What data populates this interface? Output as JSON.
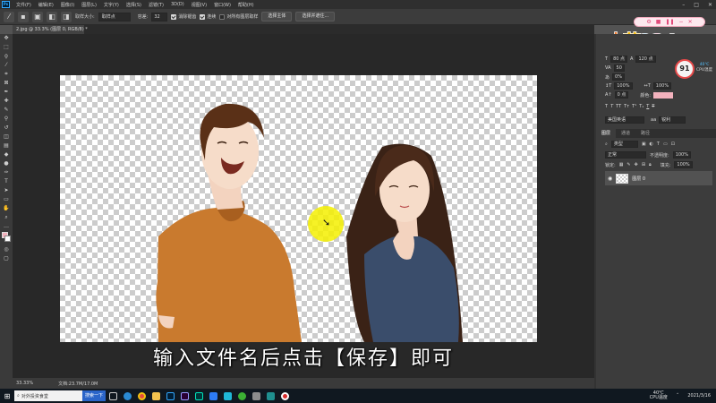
{
  "menubar": {
    "app_logo": "Ps",
    "items": [
      "文件(F)",
      "编辑(E)",
      "图像(I)",
      "图层(L)",
      "文字(Y)",
      "选择(S)",
      "滤镜(T)",
      "3D(D)",
      "视图(V)",
      "窗口(W)",
      "帮助(H)"
    ]
  },
  "options_bar": {
    "tool_icon": "magic-wand-icon",
    "sample_size_label": "取样大小:",
    "sample_size_value": "取样点",
    "tolerance_label": "容差:",
    "tolerance_value": "32",
    "anti_alias_label": "消除锯齿",
    "contiguous_label": "连续",
    "sample_all_layers_label": "对所有图层取样",
    "select_subject_button": "选择主体",
    "select_and_mask_button": "选择并遮住..."
  },
  "document_tab": {
    "title": "2.jpg @ 33.3% (图层 0, RGB/8) *"
  },
  "status_bar": {
    "zoom": "33.33%",
    "doc_info": "文档:23.7M/17.0M"
  },
  "subtitle": "输入文件名后点击【保存】即可",
  "recording_badge": {
    "icons": [
      "gear",
      "stop",
      "pause",
      "minus",
      "close"
    ]
  },
  "character_panel": {
    "font_size": "80 点",
    "leading": "120 点",
    "tracking_label": "VA",
    "tracking_value": "50",
    "kerning_value": "0%",
    "vertical_scale": "100%",
    "horizontal_scale": "100%",
    "baseline_shift": "0 点",
    "color_label": "颜色:",
    "language": "美国英语",
    "antialias": "锐利"
  },
  "cpu_monitor": {
    "usage": "91",
    "temp": "40℃",
    "label": "CPU温度"
  },
  "layers_panel": {
    "tabs": [
      "图层",
      "通道",
      "路径"
    ],
    "filter_kind": "类型",
    "blend_mode": "正常",
    "opacity_label": "不透明度:",
    "opacity_value": "100%",
    "lock_label": "锁定:",
    "fill_label": "填充:",
    "fill_value": "100%",
    "layer_name": "图层 0"
  },
  "taskbar": {
    "search_placeholder": "对外投资食堂",
    "search_button": "搜索一下",
    "tray_temp": "40℃",
    "tray_temp_label": "CPU温度",
    "date": "2021/3/16"
  },
  "colors": {
    "foreground_swatch": "#f3b2bd",
    "accent_blue": "#31a8ff",
    "shirt_orange": "#c97a2e",
    "dress_navy": "#3a4d6b"
  }
}
